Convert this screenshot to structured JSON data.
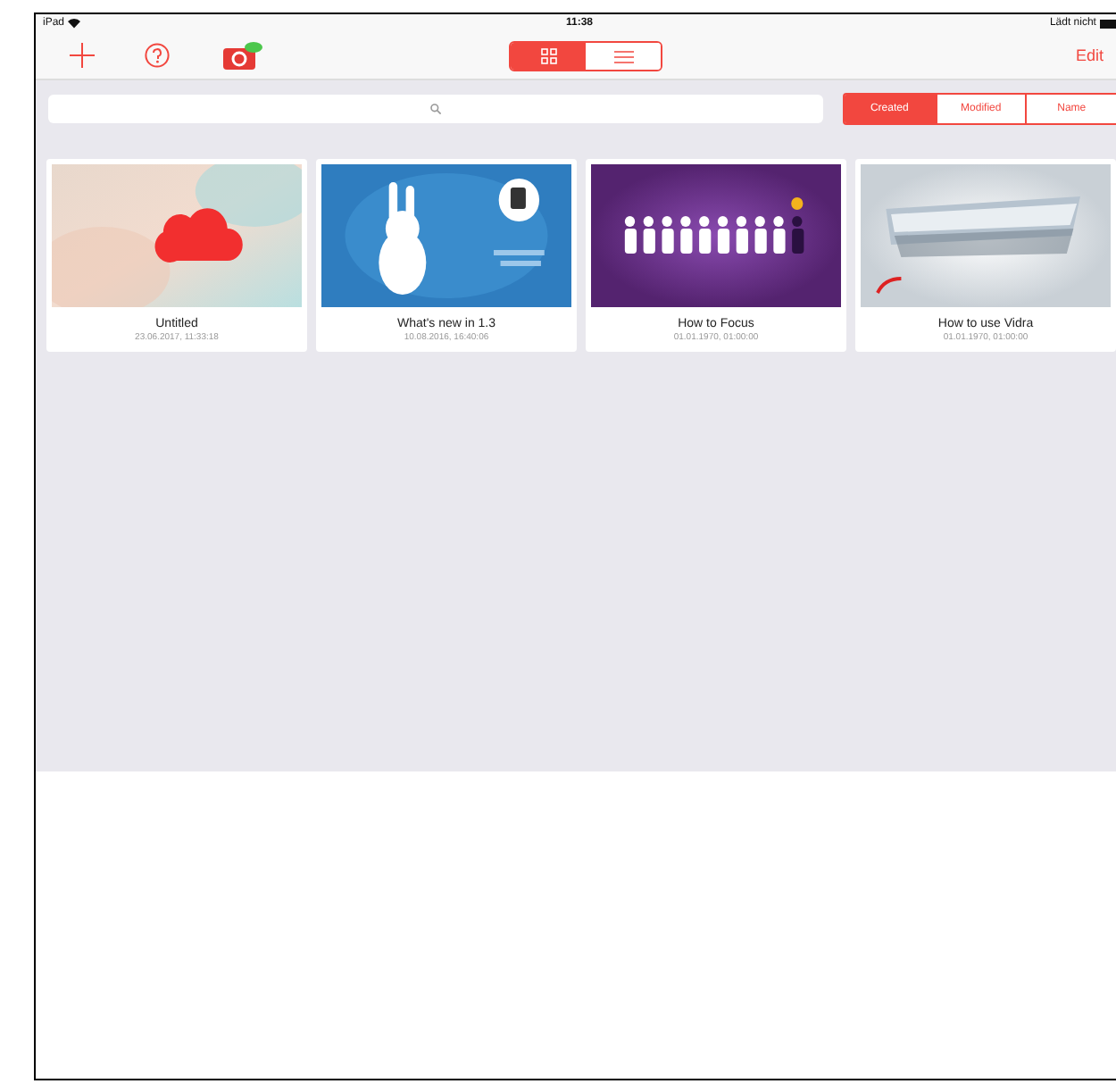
{
  "status_bar": {
    "carrier": "iPad",
    "time": "11:38",
    "battery": "Lädt nicht"
  },
  "toolbar": {
    "edit": "Edit"
  },
  "view_modes": [
    {
      "kind": "grid",
      "selected": true
    },
    {
      "kind": "list",
      "selected": false
    }
  ],
  "sort_options": [
    {
      "label": "Created",
      "selected": true
    },
    {
      "label": "Modified",
      "selected": false
    },
    {
      "label": "Name",
      "selected": false
    }
  ],
  "documents": [
    {
      "title": "Untitled",
      "date": "23.06.2017, 11:33:18"
    },
    {
      "title": "What's new in 1.3",
      "date": "10.08.2016, 16:40:06"
    },
    {
      "title": "How to Focus",
      "date": "01.01.1970, 01:00:00"
    },
    {
      "title": "How to use Vidra",
      "date": "01.01.1970, 01:00:00"
    }
  ]
}
